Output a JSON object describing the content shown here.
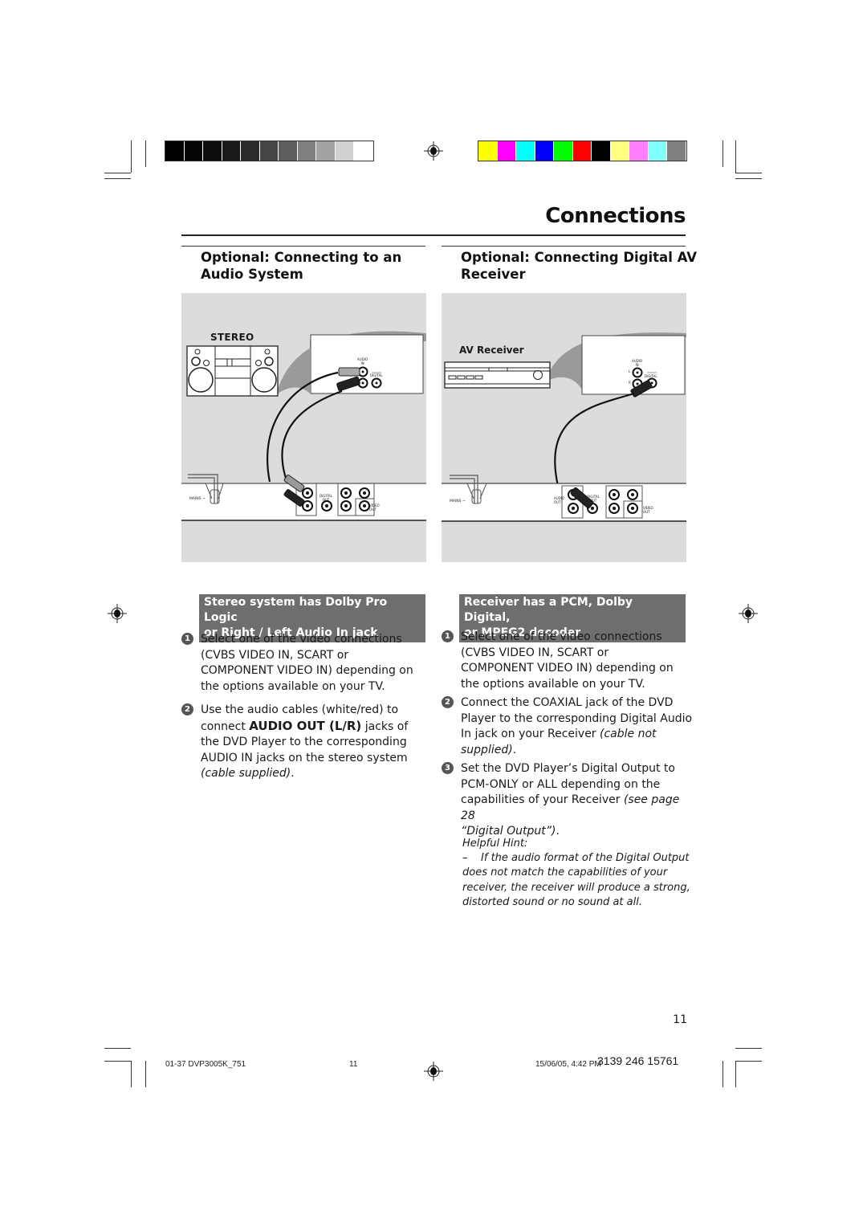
{
  "print_marks": {
    "grayscale_swatches": [
      "#000000",
      "#050505",
      "#0d0d0d",
      "#1a1a1a",
      "#2b2b2b",
      "#444444",
      "#5e5e5e",
      "#808080",
      "#a3a3a3",
      "#d0d0d0",
      "#ffffff"
    ],
    "color_swatches": [
      "#ffff00",
      "#ff00ff",
      "#00ffff",
      "#0000ff",
      "#00ff00",
      "#ff0000",
      "#000000",
      "#ffff80",
      "#ff80ff",
      "#80ffff",
      "#808080"
    ]
  },
  "page": {
    "title": "Connections",
    "page_number": "11"
  },
  "left_section": {
    "heading_line1": "Optional: Connecting to an",
    "heading_line2": "Audio System",
    "illustration": {
      "device_label": "STEREO",
      "stereo_jack_label_top": "AUDIO",
      "stereo_jack_label_in": "IN",
      "stereo_digital_label": "DIGITAL",
      "mains_label": "MAINS ~",
      "dvd_digital_out": "DIGITAL OUT",
      "dvd_video_out": "VIDEO OUT"
    },
    "band_line1": "Stereo system has Dolby Pro Logic",
    "band_line2": "or Right / Left Audio In jack",
    "steps": [
      {
        "number": "1",
        "lines": [
          "Select one of the video connections",
          "(CVBS VIDEO IN, SCART or",
          "COMPONENT VIDEO IN) depending on",
          "the options available on your TV."
        ]
      },
      {
        "number": "2",
        "line1": "Use the audio cables (white/red) to",
        "line2_pre": "connect ",
        "line2_bold": "AUDIO OUT (L/R)",
        "line2_post": " jacks of",
        "line3": "the DVD Player to the corresponding",
        "line4": "AUDIO IN jacks on the stereo system",
        "line5_italic": "(cable supplied)",
        "line5_post": "."
      }
    ]
  },
  "right_section": {
    "heading_line1": "Optional: Connecting Digital AV",
    "heading_line2": "Receiver",
    "illustration": {
      "device_label": "AV Receiver",
      "receiver_jack_label_top": "AUDIO",
      "receiver_jack_label_in": "IN",
      "receiver_l": "L",
      "receiver_r": "R",
      "receiver_digital_label": "DIGITAL",
      "mains_label": "MAINS ~",
      "dvd_audio_out": "AUDIO OUT",
      "dvd_digital_out": "DIGITAL OUT",
      "dvd_video_out": "VIDEO OUT"
    },
    "band_line1": "Receiver has a PCM, Dolby Digital,",
    "band_line2": "or MPEG2 decoder",
    "steps": [
      {
        "number": "1",
        "lines": [
          "Select one of the video connections",
          "(CVBS VIDEO IN, SCART or",
          "COMPONENT VIDEO IN) depending on",
          "the options available on your TV."
        ]
      },
      {
        "number": "2",
        "line1": "Connect the COAXIAL jack of the DVD",
        "line2": "Player to the corresponding Digital Audio",
        "line3_pre": "In jack on your Receiver ",
        "line3_italic": "(cable not",
        "line4_italic": "supplied)",
        "line4_post": "."
      },
      {
        "number": "3",
        "line1": "Set the DVD Player’s Digital Output to",
        "line2": "PCM-ONLY or ALL depending on the",
        "line3_pre": "capabilities of your Receiver ",
        "line3_italic": "(see page 28",
        "line4_italic": "“Digital Output”)",
        "line4_post": "."
      }
    ],
    "hint": {
      "title": "Helpful Hint:",
      "line1": "–    If the audio format of the Digital Output",
      "line2": "does not match the capabilities of your",
      "line3": "receiver, the receiver will produce a strong,",
      "line4": "distorted sound or no sound at all."
    }
  },
  "footer": {
    "file_name": "01-37 DVP3005K_751",
    "sheet_number": "11",
    "timestamp": "15/06/05, 4:42 PM",
    "part_number": "3139 246 15761"
  }
}
